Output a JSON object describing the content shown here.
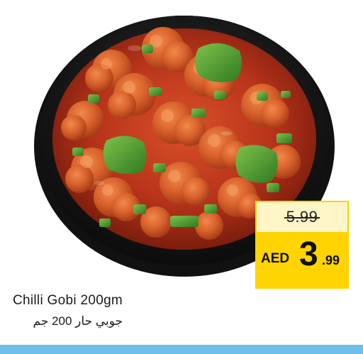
{
  "product": {
    "name_en": "Chilli Gobi 200gm",
    "name_ar": "جوبي حار 200 جم",
    "image_alt": "bowl of chilli gobi with cauliflower and green peppers"
  },
  "price": {
    "old": "5.99",
    "currency": "AED",
    "new_integer": "3",
    "new_decimal": ".99"
  },
  "colors": {
    "price_tag_yellow": "#ffd400",
    "old_price_bg": "#fff6c8",
    "bottom_bar": "#6ec0ea",
    "sauce": "#b8341a"
  }
}
